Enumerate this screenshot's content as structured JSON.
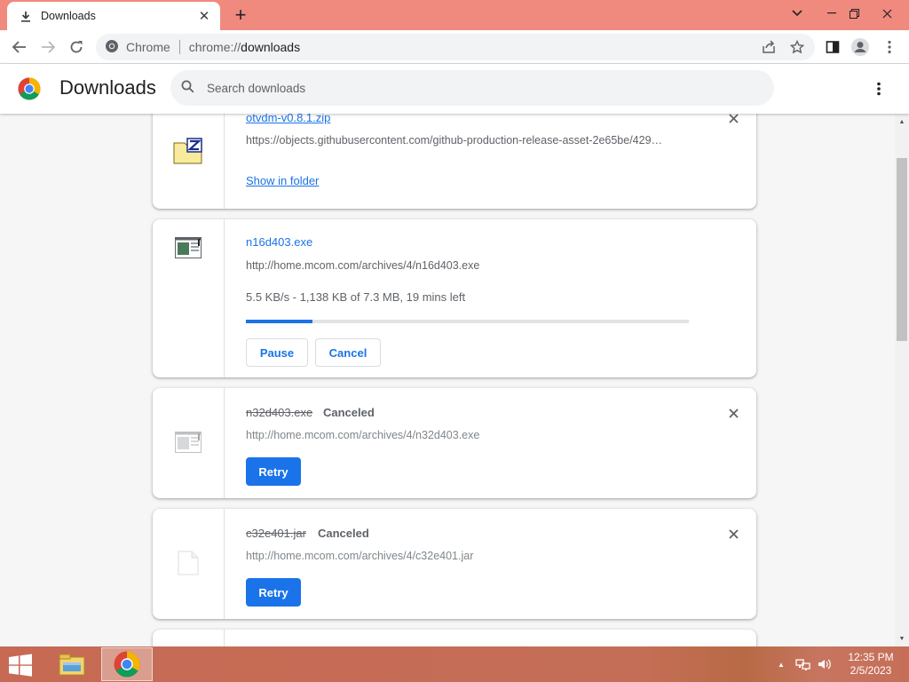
{
  "tab": {
    "title": "Downloads",
    "close_glyph": "✕",
    "new_tab_glyph": "+"
  },
  "window_controls": {
    "chevron": "⌄",
    "minimize": "—",
    "restore": "❐",
    "close": "✕"
  },
  "address_bar": {
    "site_label": "Chrome",
    "url_scheme": "chrome://",
    "url_path": "downloads"
  },
  "header": {
    "title": "Downloads",
    "search_placeholder": "Search downloads",
    "search_value": ""
  },
  "downloads": [
    {
      "file_name": "otvdm-v0.8.1.zip",
      "url": "https://objects.githubusercontent.com/github-production-release-asset-2e65be/429…",
      "action_link": "Show in folder",
      "icon": "zip-archive-icon",
      "state": "complete"
    },
    {
      "file_name": "n16d403.exe",
      "url": "http://home.mcom.com/archives/4/n16d403.exe",
      "progress_text": "5.5 KB/s - 1,138 KB of 7.3 MB, 19 mins left",
      "progress_fraction": 0.15,
      "buttons": {
        "pause": "Pause",
        "cancel": "Cancel"
      },
      "icon": "exe-window-icon",
      "state": "in_progress"
    },
    {
      "file_name": "n32d403.exe",
      "status": "Canceled",
      "url": "http://home.mcom.com/archives/4/n32d403.exe",
      "retry_label": "Retry",
      "icon": "exe-window-icon",
      "state": "canceled"
    },
    {
      "file_name": "c32e401.jar",
      "status": "Canceled",
      "url": "http://home.mcom.com/archives/4/c32e401.jar",
      "retry_label": "Retry",
      "icon": "blank-file-icon",
      "state": "canceled"
    }
  ],
  "taskbar": {
    "apps": [
      "file-explorer-icon",
      "chrome-icon"
    ],
    "clock_time": "12:35 PM",
    "clock_date": "2/5/2023",
    "tray_up_glyph": "▲"
  },
  "colors": {
    "accent": "#1a73e8",
    "titlebar": "#f08a7e",
    "taskbar": "#c66a54"
  }
}
